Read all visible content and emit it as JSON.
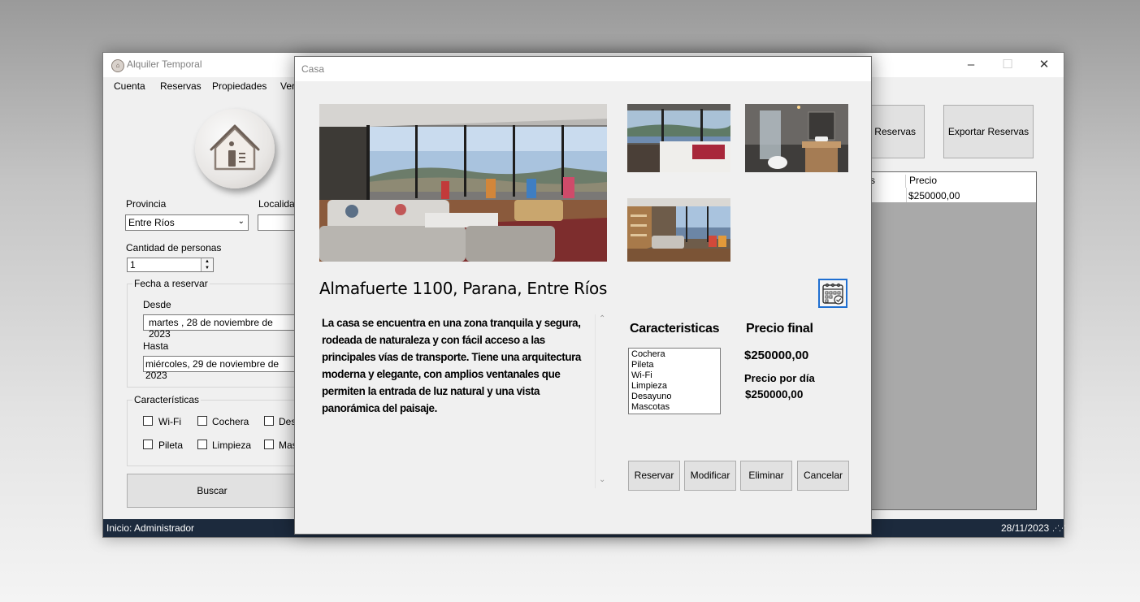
{
  "main_window": {
    "title": "Alquiler Temporal",
    "menu": [
      "Cuenta",
      "Reservas",
      "Propiedades",
      "Ver"
    ],
    "provincia_label": "Provincia",
    "provincia_value": "Entre Ríos",
    "localidad_label": "Localidad",
    "localidad_value": "",
    "cantidad_label": "Cantidad de personas",
    "cantidad_value": "1",
    "fecha_group_label": "Fecha a reservar",
    "desde_label": "Desde",
    "desde_value": "martes   , 28 de noviembre de 2023",
    "hasta_label": "Hasta",
    "hasta_value": "miércoles, 29 de noviembre de 2023",
    "caracteristicas_group_label": "Características",
    "checkboxes": [
      "Wi-Fi",
      "Cochera",
      "Des",
      "Pileta",
      "Limpieza",
      "Mas"
    ],
    "buscar_label": "Buscar",
    "importar_label": "tar Reservas",
    "exportar_label": "Exportar Reservas",
    "grid": {
      "columns": [
        "onas",
        "Precio"
      ],
      "rows": [
        [
          "",
          "$250000,00"
        ]
      ]
    },
    "status_left": "Inicio: Administrador",
    "status_right": "28/11/2023"
  },
  "dialog": {
    "title": "Casa",
    "address": "Almafuerte 1100, Parana, Entre Ríos",
    "description": "La casa se encuentra en una zona tranquila y segura, rodeada de naturaleza y con fácil acceso a las principales vías de transporte. Tiene una arquitectura moderna y elegante, con amplios ventanales que permiten la entrada de luz natural y una vista panorámica del paisaje.",
    "features_title": "Caracteristicas",
    "features": [
      "Cochera",
      "Pileta",
      "Wi-Fi",
      "Limpieza",
      "Desayuno",
      "Mascotas"
    ],
    "price_title": "Precio final",
    "price_final": "$250000,00",
    "price_day_label": "Precio por día",
    "price_day": "$250000,00",
    "buttons": {
      "reservar": "Reservar",
      "modificar": "Modificar",
      "eliminar": "Eliminar",
      "cancelar": "Cancelar"
    }
  },
  "icons": [
    "house-logo-icon",
    "calendar-check-icon",
    "minimize-icon",
    "maximize-icon",
    "close-icon",
    "chevron-down-icon",
    "resize-grip-icon"
  ],
  "colors": {
    "statusbar": "#1c2a3d",
    "calendar_border": "#1f6fd1",
    "grid_background": "#a9a9a9"
  }
}
